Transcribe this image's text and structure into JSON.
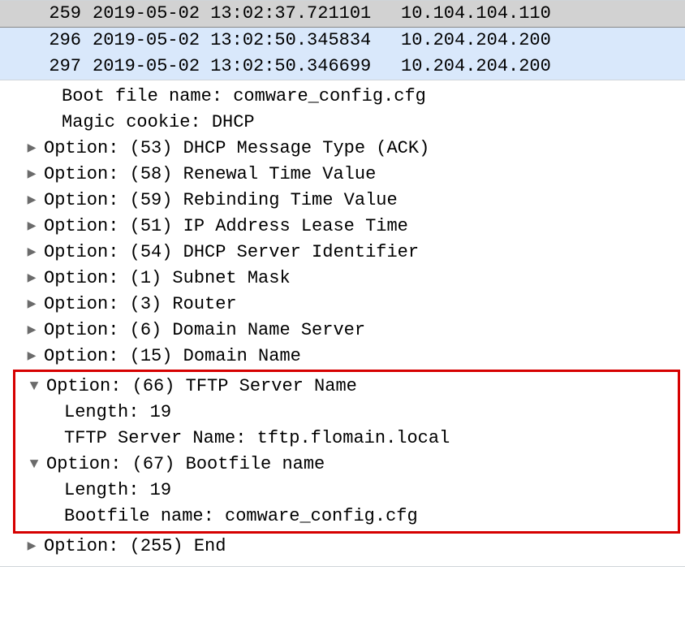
{
  "packet_list": [
    {
      "no": "259",
      "time": "2019-05-02 13:02:37.721101",
      "src": "10.104.104.110",
      "state": "selected"
    },
    {
      "no": "296",
      "time": "2019-05-02 13:02:50.345834",
      "src": "10.204.204.200",
      "state": "related"
    },
    {
      "no": "297",
      "time": "2019-05-02 13:02:50.346699",
      "src": "10.204.204.200",
      "state": "related"
    }
  ],
  "details": {
    "boot_file_name": "Boot file name: comware_config.cfg",
    "magic_cookie": "Magic cookie: DHCP",
    "options_top": [
      "Option: (53) DHCP Message Type (ACK)",
      "Option: (58) Renewal Time Value",
      "Option: (59) Rebinding Time Value",
      "Option: (51) IP Address Lease Time",
      "Option: (54) DHCP Server Identifier",
      "Option: (1) Subnet Mask",
      "Option: (3) Router",
      "Option: (6) Domain Name Server",
      "Option: (15) Domain Name"
    ],
    "opt66": {
      "header": "Option: (66) TFTP Server Name",
      "length": "Length: 19",
      "value": "TFTP Server Name: tftp.flomain.local"
    },
    "opt67": {
      "header": "Option: (67) Bootfile name",
      "length": "Length: 19",
      "value": "Bootfile name: comware_config.cfg"
    },
    "option_end": "Option: (255) End"
  }
}
